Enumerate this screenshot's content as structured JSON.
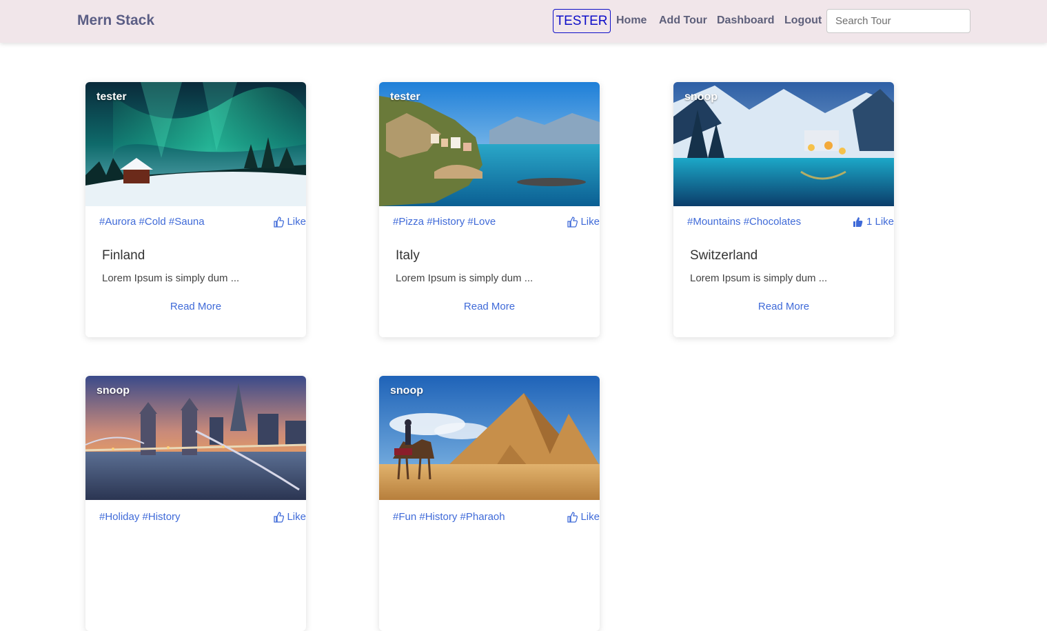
{
  "navbar": {
    "brand": "Mern Stack",
    "user_badge": "TESTER",
    "links": [
      "Home",
      "Add Tour",
      "Dashboard",
      "Logout"
    ],
    "search_placeholder": "Search Tour"
  },
  "tours": [
    {
      "creator": "tester",
      "tags": "#Aurora #Cold #Sauna",
      "like_label": "Like",
      "liked": false,
      "title": "Finland",
      "description": "Lorem Ipsum is simply dum ...",
      "read_more": "Read More"
    },
    {
      "creator": "tester",
      "tags": "#Pizza #History #Love",
      "like_label": "Like",
      "liked": false,
      "title": "Italy",
      "description": "Lorem Ipsum is simply dum ...",
      "read_more": "Read More"
    },
    {
      "creator": "snoop",
      "tags": "#Mountains #Chocolates",
      "like_label": "1 Like",
      "liked": true,
      "title": "Switzerland",
      "description": "Lorem Ipsum is simply dum ...",
      "read_more": "Read More"
    },
    {
      "creator": "snoop",
      "tags": "#Holiday #History",
      "like_label": "Like",
      "liked": false,
      "title": "",
      "description": "",
      "read_more": ""
    },
    {
      "creator": "snoop",
      "tags": "#Fun #History #Pharaoh",
      "like_label": "Like",
      "liked": false,
      "title": "",
      "description": "",
      "read_more": ""
    }
  ],
  "colors": {
    "navbar_bg": "#f1e6ea",
    "brand": "#5b5e85",
    "link_accent": "#3f6ad8",
    "badge": "#0d0dc8"
  },
  "icons": {
    "like_outline": "thumbs-up-outline-icon",
    "like_filled": "thumbs-up-filled-icon"
  }
}
